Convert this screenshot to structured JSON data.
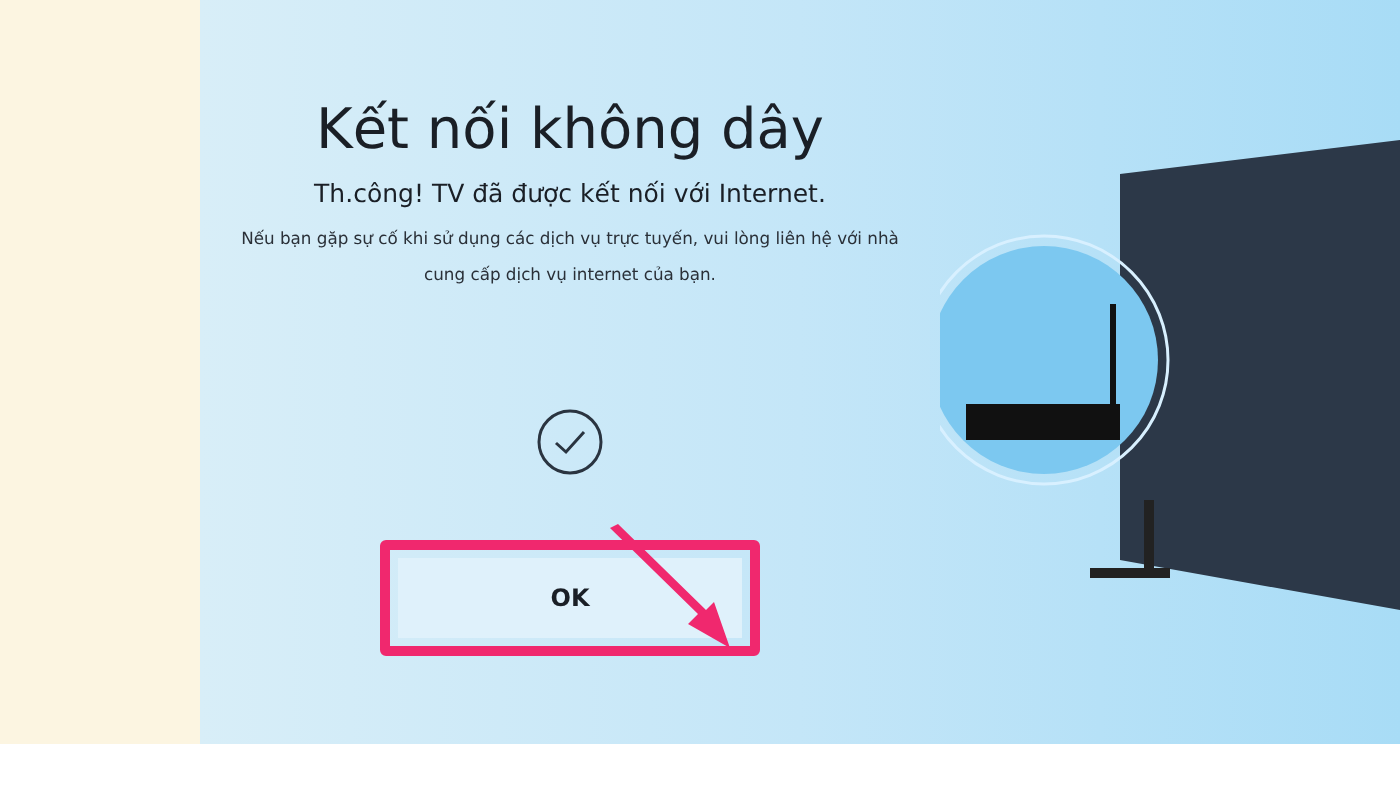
{
  "title": "Kết nối không dây",
  "status": "Th.công! TV đã được kết nối với Internet.",
  "message": "Nếu bạn gặp sự cố khi sử dụng các dịch vụ trực tuyến, vui lòng liên hệ với nhà cung cấp dịch vụ internet của bạn.",
  "buttons": [
    {
      "label": "OK",
      "selected": true
    }
  ]
}
